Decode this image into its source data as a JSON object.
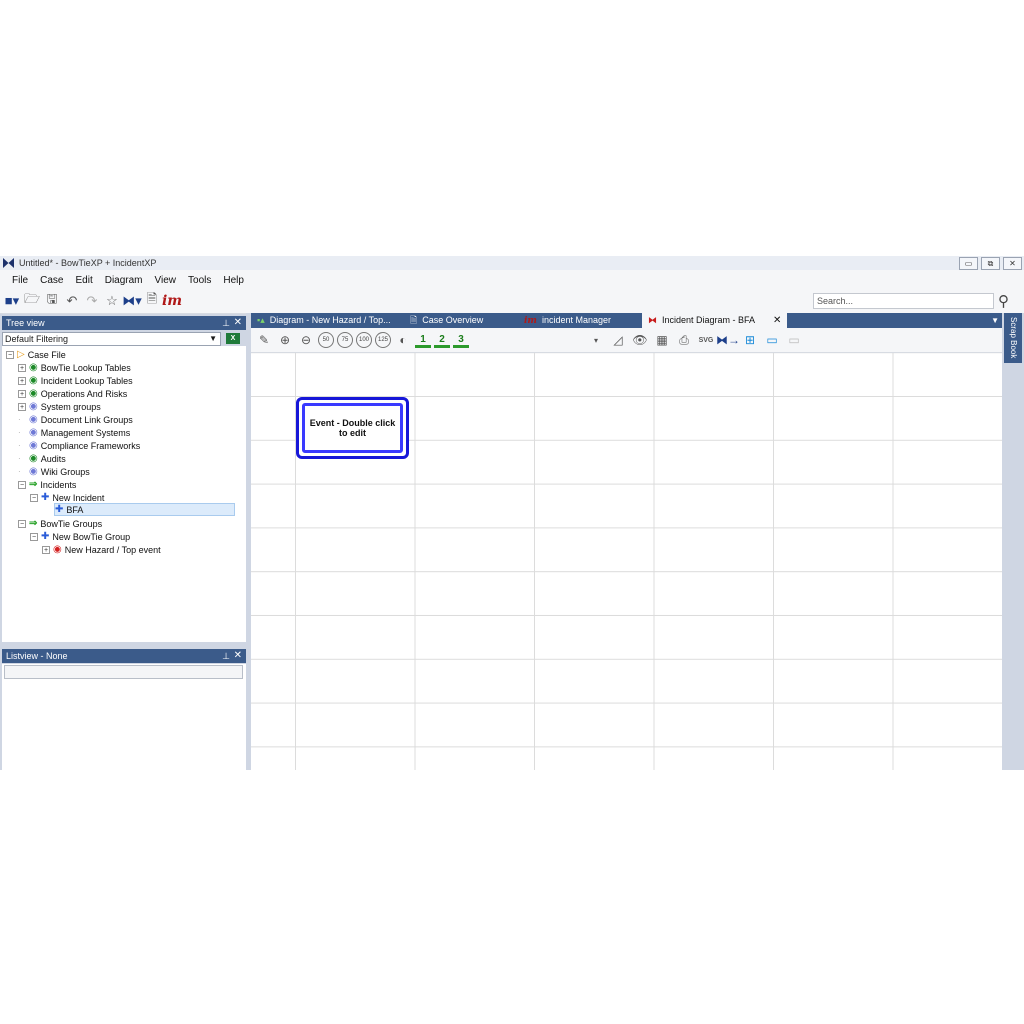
{
  "window": {
    "title": "Untitled* - BowTieXP + IncidentXP",
    "controls": [
      "▭",
      "⧉",
      "✕"
    ]
  },
  "menu": [
    "File",
    "Case",
    "Edit",
    "Diagram",
    "View",
    "Tools",
    "Help"
  ],
  "toolbar": {
    "search_placeholder": "Search...",
    "logo_text": "im"
  },
  "treeview": {
    "header": "Tree view",
    "filter": "Default Filtering",
    "items": [
      {
        "label": "Case File"
      },
      {
        "label": "BowTie Lookup Tables"
      },
      {
        "label": "Incident Lookup Tables"
      },
      {
        "label": "Operations And Risks"
      },
      {
        "label": "System groups"
      },
      {
        "label": "Document Link Groups"
      },
      {
        "label": "Management Systems"
      },
      {
        "label": "Compliance Frameworks"
      },
      {
        "label": "Audits"
      },
      {
        "label": "Wiki Groups"
      },
      {
        "label": "Incidents"
      },
      {
        "label": "New Incident"
      },
      {
        "label": "BFA"
      },
      {
        "label": "BowTie Groups"
      },
      {
        "label": "New BowTie Group"
      },
      {
        "label": "New Hazard / Top event"
      }
    ]
  },
  "listview": {
    "header": "Listview - None"
  },
  "tabs": [
    {
      "label": "Diagram - New Hazard / Top..."
    },
    {
      "label": "Case Overview"
    },
    {
      "label": "incident Manager"
    },
    {
      "label": "Incident Diagram - BFA"
    }
  ],
  "diagram_toolbar": {
    "zoom_levels": [
      "50",
      "75",
      "100",
      "125"
    ],
    "levels": [
      "1",
      "2",
      "3"
    ]
  },
  "canvas": {
    "event_node_text": "Event - Double click to edit"
  },
  "scrapbook": {
    "label": "Scrap Book"
  }
}
